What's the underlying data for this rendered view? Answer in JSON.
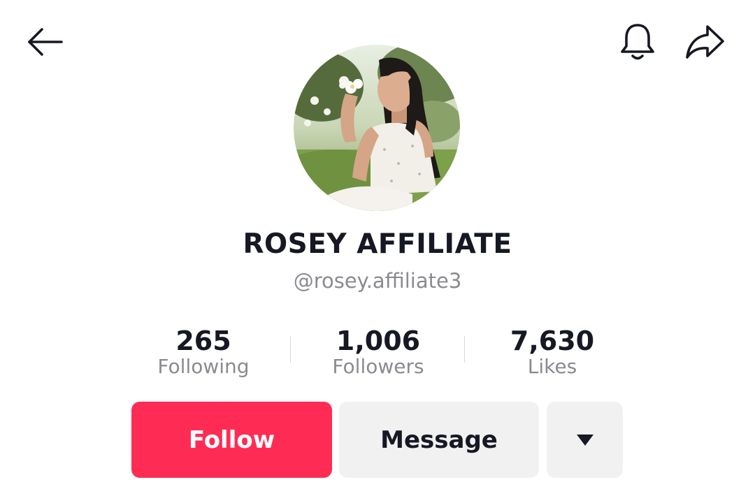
{
  "header": {
    "back_icon": "arrow-left-icon",
    "notification_icon": "bell-icon",
    "share_icon": "share-arrow-icon"
  },
  "profile": {
    "display_name": "ROSEY AFFILIATE",
    "username": "@rosey.affiliate3",
    "avatar_icon": "profile-photo"
  },
  "stats": [
    {
      "value": "265",
      "label": "Following"
    },
    {
      "value": "1,006",
      "label": "Followers"
    },
    {
      "value": "7,630",
      "label": "Likes"
    }
  ],
  "actions": {
    "follow_label": "Follow",
    "message_label": "Message",
    "more_icon": "caret-down-icon"
  },
  "colors": {
    "follow_accent": "#fe2c55",
    "secondary_button": "#f1f1f2",
    "primary_text": "#161823",
    "secondary_text": "#8a8b91"
  }
}
